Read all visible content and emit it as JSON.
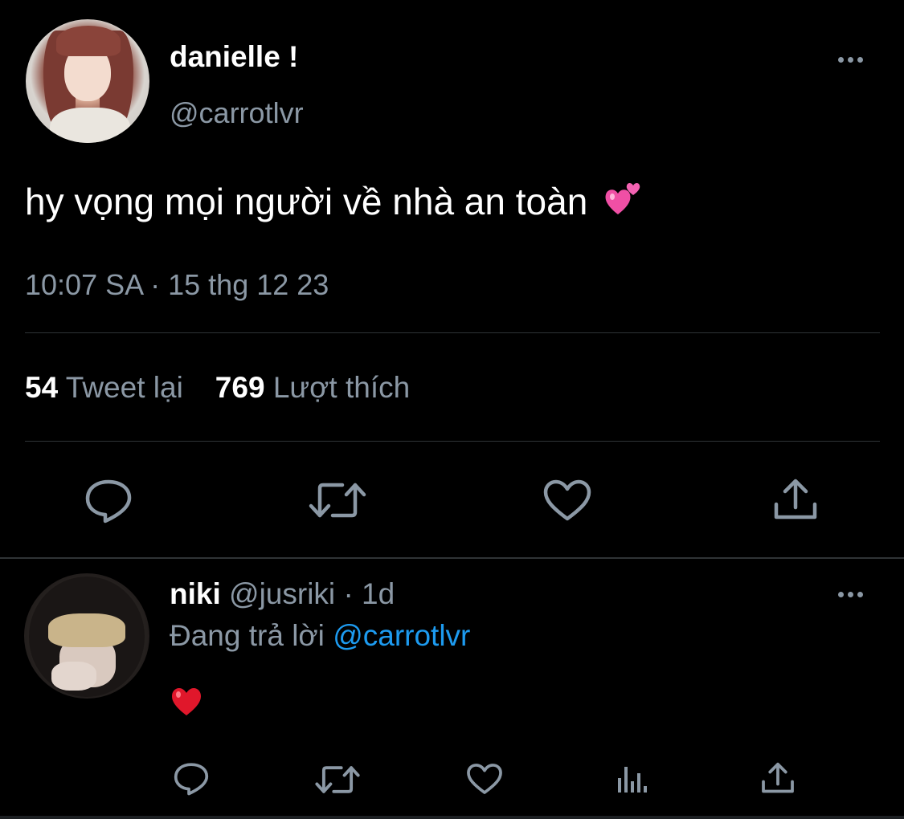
{
  "colors": {
    "background": "#000000",
    "primary_text": "#ffffff",
    "secondary_text": "#8b98a5",
    "link": "#1d9bf0",
    "divider": "#2f3336",
    "emoji_pink": "#f04fa5",
    "emoji_red": "#e0172b"
  },
  "main_tweet": {
    "display_name": "danielle !",
    "handle": "@carrotlvr",
    "avatar_icon": "profile-photo",
    "more_icon": "more-dots-icon",
    "text": "hy vọng mọi người về nhà an toàn",
    "emoji_icon": "two-hearts-emoji",
    "timestamp": "10:07 SA · 15 thg 12 23",
    "retweet_count": "54",
    "retweet_label": "Tweet lại",
    "like_count": "769",
    "like_label": "Lượt thích",
    "actions": [
      "reply-icon",
      "retweet-icon",
      "like-icon",
      "share-icon"
    ]
  },
  "reply_tweet": {
    "display_name": "niki",
    "handle": "@jusriki",
    "separator": "·",
    "age": "1d",
    "replying_prefix": "Đang trả lời",
    "replying_to": "@carrotlvr",
    "text_emoji_icon": "red-heart-emoji",
    "avatar_icon": "profile-photo",
    "more_icon": "more-dots-icon",
    "actions": [
      "reply-icon",
      "retweet-icon",
      "like-icon",
      "analytics-icon",
      "share-icon"
    ]
  }
}
